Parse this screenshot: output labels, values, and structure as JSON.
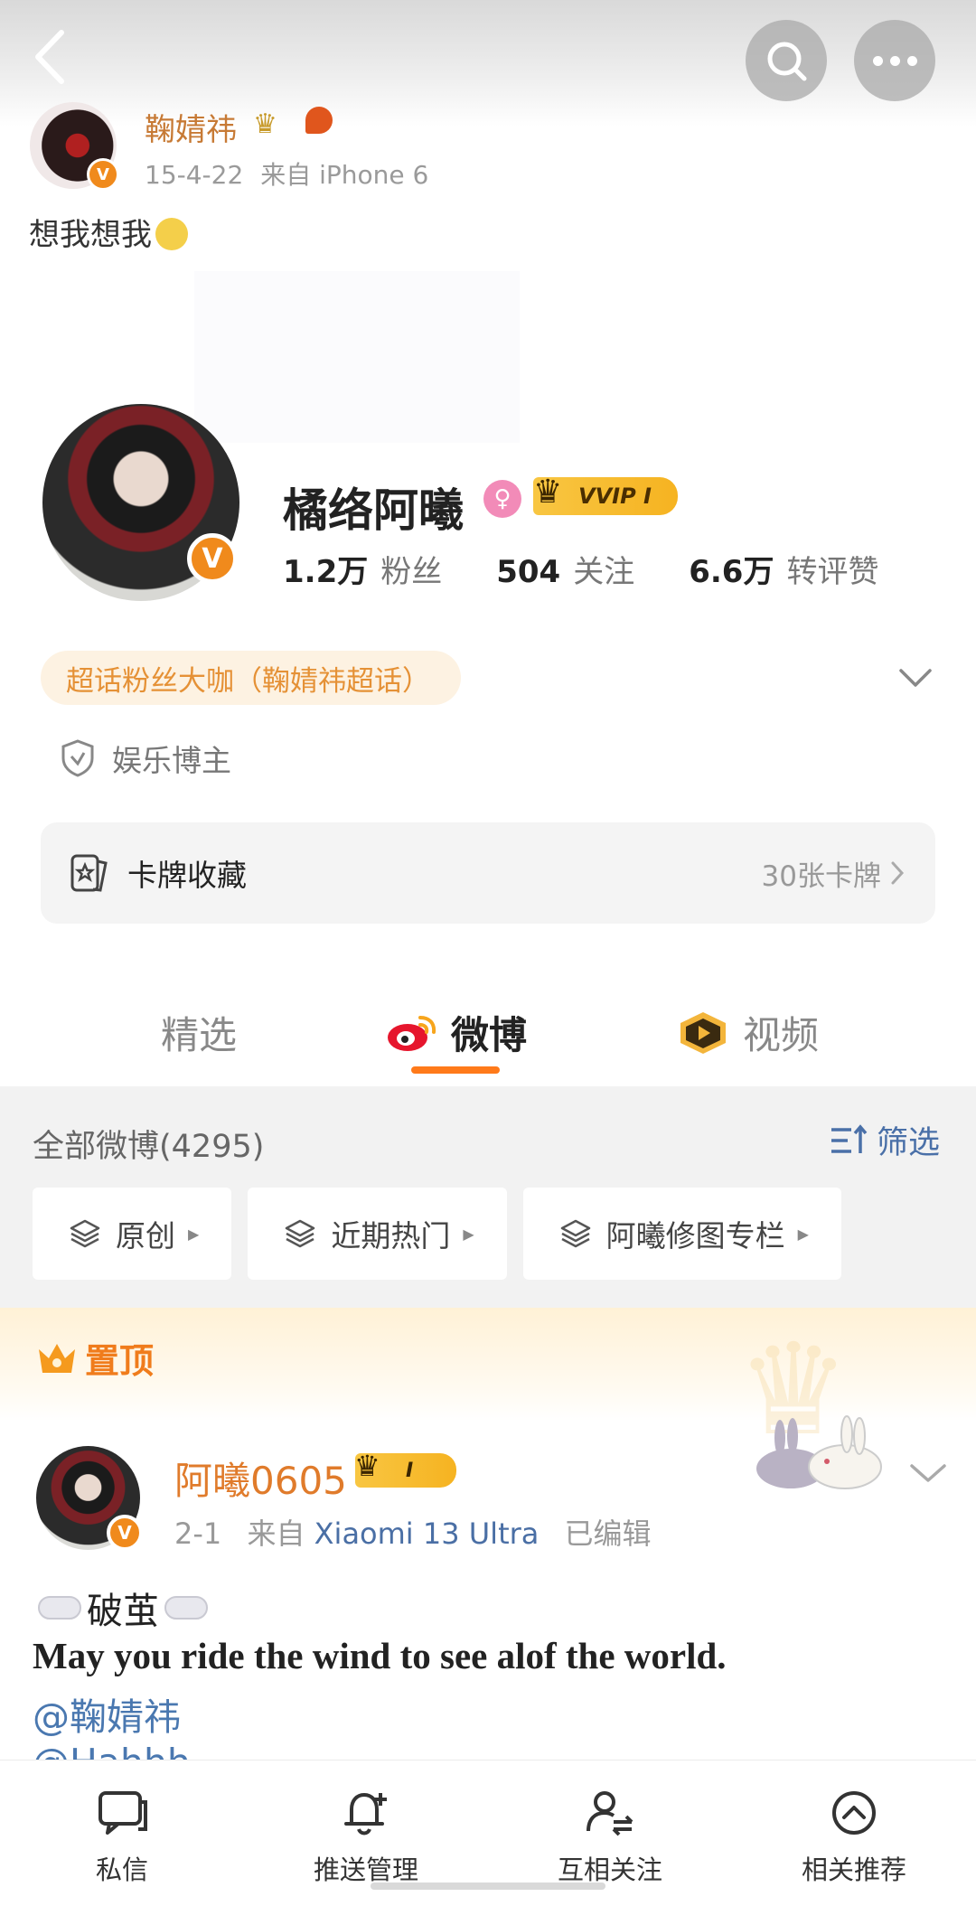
{
  "old_post": {
    "author": "鞠婧祎",
    "date": "15-4-22",
    "source_prefix": "来自",
    "device": "iPhone 6",
    "text": "想我想我",
    "avatar_badge": "V"
  },
  "profile": {
    "name": "橘络阿曦",
    "vvip_label": "VVIP I",
    "avatar_badge": "V",
    "stats": [
      {
        "num": "1.2万",
        "label": "粉丝"
      },
      {
        "num": "504",
        "label": "关注"
      },
      {
        "num": "6.6万",
        "label": "转评赞"
      }
    ],
    "super_badge": "超话粉丝大咖（鞠婧祎超话）",
    "category": "娱乐博主",
    "cards": {
      "label": "卡牌收藏",
      "count": "30张卡牌"
    }
  },
  "tabs": [
    {
      "label": "精选"
    },
    {
      "label": "微博"
    },
    {
      "label": "视频"
    }
  ],
  "filters": {
    "all_posts": "全部微博(4295)",
    "filter_label": "筛选",
    "chips": [
      "原创",
      "近期热门",
      "阿曦修图专栏"
    ]
  },
  "pinned": {
    "label": "置顶"
  },
  "post": {
    "author": "阿曦0605",
    "vip_label": "I",
    "avatar_badge": "V",
    "date": "2-1",
    "source_prefix": "来自",
    "device": "Xiaomi 13 Ultra",
    "edited": "已编辑",
    "line1": "破茧",
    "line2": "May you ride the wind to see alof the world.",
    "mention": "@鞠婧祎",
    "mention_cut": "@Hahhh"
  },
  "bottom_nav": [
    {
      "label": "私信",
      "icon": "message-icon"
    },
    {
      "label": "推送管理",
      "icon": "bell-plus-icon"
    },
    {
      "label": "互相关注",
      "icon": "mutual-follow-icon"
    },
    {
      "label": "相关推荐",
      "icon": "recommend-icon"
    }
  ],
  "colors": {
    "accent_orange": "#ff7a1a",
    "link_blue": "#4a78b0",
    "vip_gold": "#f6b321"
  }
}
